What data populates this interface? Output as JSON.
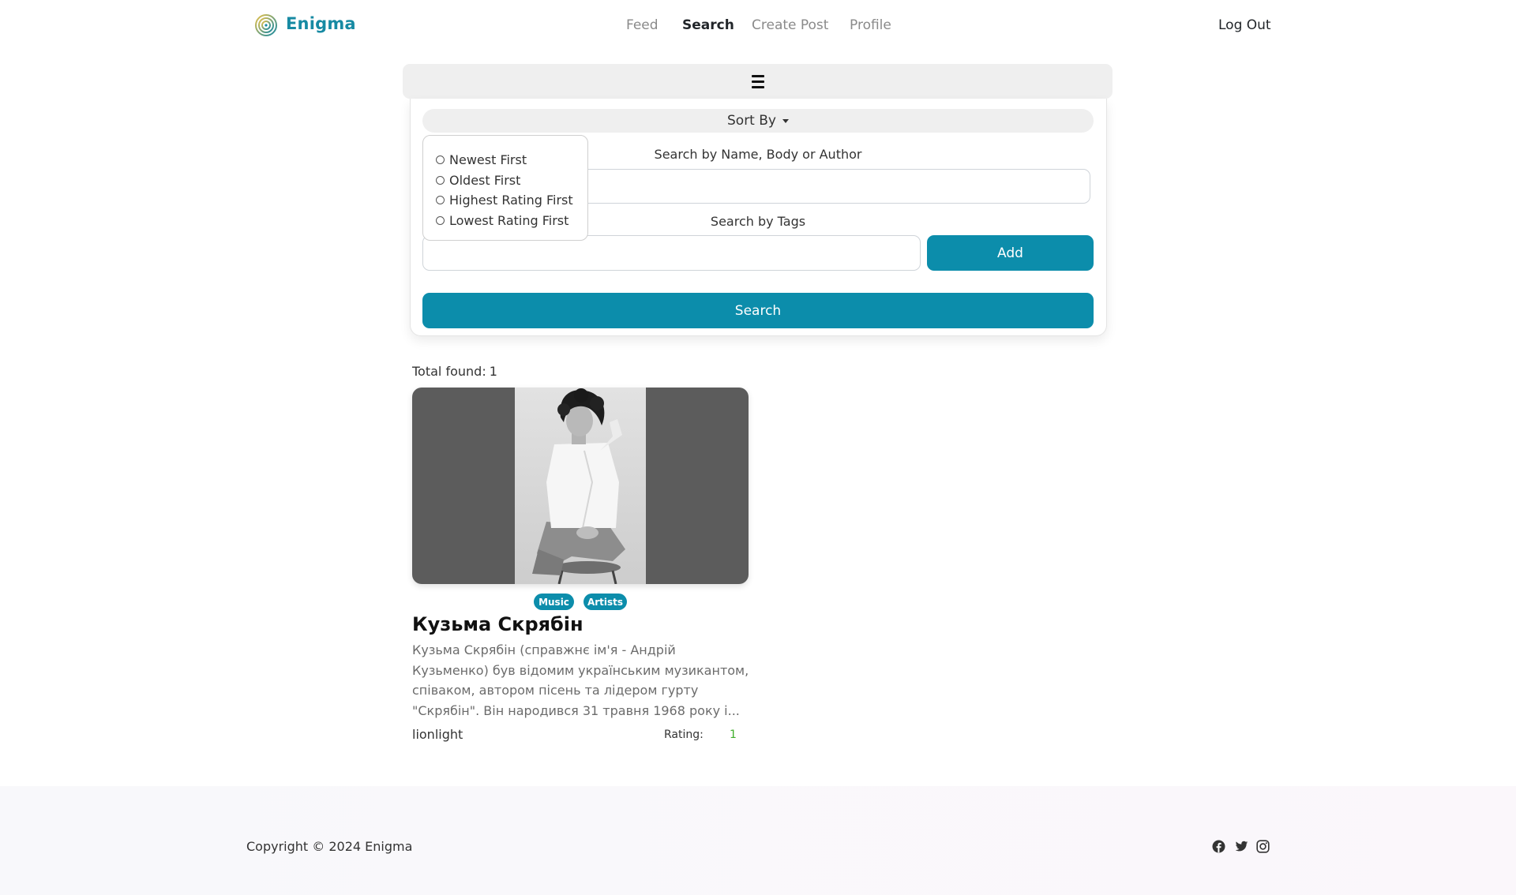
{
  "brand": {
    "name": "Enigma",
    "accent": "#178aa3"
  },
  "nav": {
    "items": [
      {
        "label": "Feed",
        "active": false
      },
      {
        "label": "Search",
        "active": true
      },
      {
        "label": "Create Post",
        "active": false
      },
      {
        "label": "Profile",
        "active": false
      }
    ],
    "logout_label": "Log Out"
  },
  "filters": {
    "toggle_icon": "hamburger-icon",
    "sort_by_label": "Sort By",
    "sort_options": [
      {
        "label": "Newest First",
        "selected": false
      },
      {
        "label": "Oldest First",
        "selected": false
      },
      {
        "label": "Highest Rating First",
        "selected": false
      },
      {
        "label": "Lowest Rating First",
        "selected": false
      }
    ],
    "name_label": "Search by Name, Body or Author",
    "name_value": "",
    "tags_label": "Search by Tags",
    "tags_value": "",
    "add_label": "Add",
    "search_label": "Search",
    "button_color": "#0c8dab"
  },
  "results": {
    "total_label": "Total found:",
    "total_count": "1",
    "posts": [
      {
        "tags": [
          "Music",
          "Artists"
        ],
        "title": "Кузьма Скрябін",
        "excerpt": "Кузьма Скрябін (справжнє ім'я - Андрій Кузьменко) був відомим українським музикантом, співаком, автором пісень та лідером гурту \"Скрябін\". Він народився 31 травня 1968 року і...",
        "author": "lionlight",
        "rating_label": "Rating:",
        "rating_value": "1"
      }
    ]
  },
  "footer": {
    "copyright": "Copyright © 2024 Enigma",
    "social_icons": [
      "facebook-icon",
      "twitter-icon",
      "instagram-icon"
    ]
  }
}
